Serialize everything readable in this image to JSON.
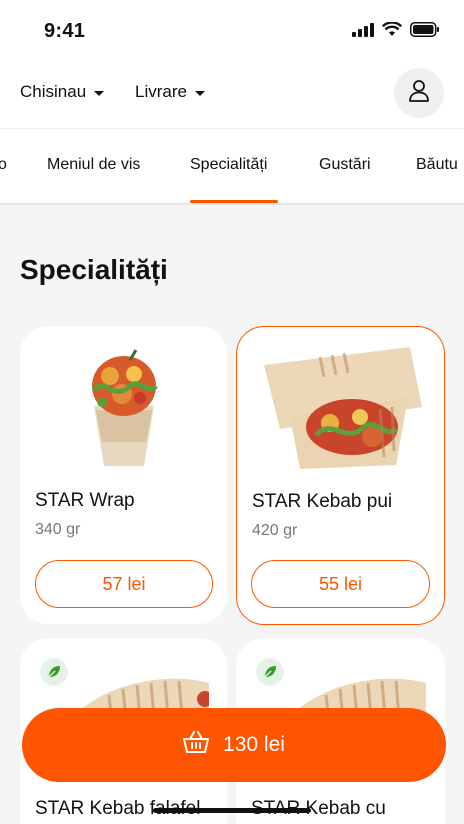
{
  "status_bar": {
    "time": "9:41"
  },
  "header": {
    "city": "Chisinau",
    "delivery_mode": "Livrare"
  },
  "tabs": [
    {
      "label": "o"
    },
    {
      "label": "Meniul de vis"
    },
    {
      "label": "Specialități",
      "active": true
    },
    {
      "label": "Gustări"
    },
    {
      "label": "Băutu"
    }
  ],
  "section": {
    "title": "Specialități"
  },
  "products": [
    {
      "name": "STAR Wrap",
      "weight": "340 gr",
      "price": "57 lei",
      "selected": false
    },
    {
      "name": "STAR Kebab pui",
      "weight": "420 gr",
      "price": "55 lei",
      "selected": true
    },
    {
      "name": "STAR Kebab falafel",
      "vegetarian": true
    },
    {
      "name": "STAR Kebab cu",
      "vegetarian": true
    }
  ],
  "cart": {
    "total": "130 lei"
  },
  "colors": {
    "accent": "#ff5500",
    "background": "#f5f5f5",
    "veg_badge": "#3a9a2e"
  }
}
